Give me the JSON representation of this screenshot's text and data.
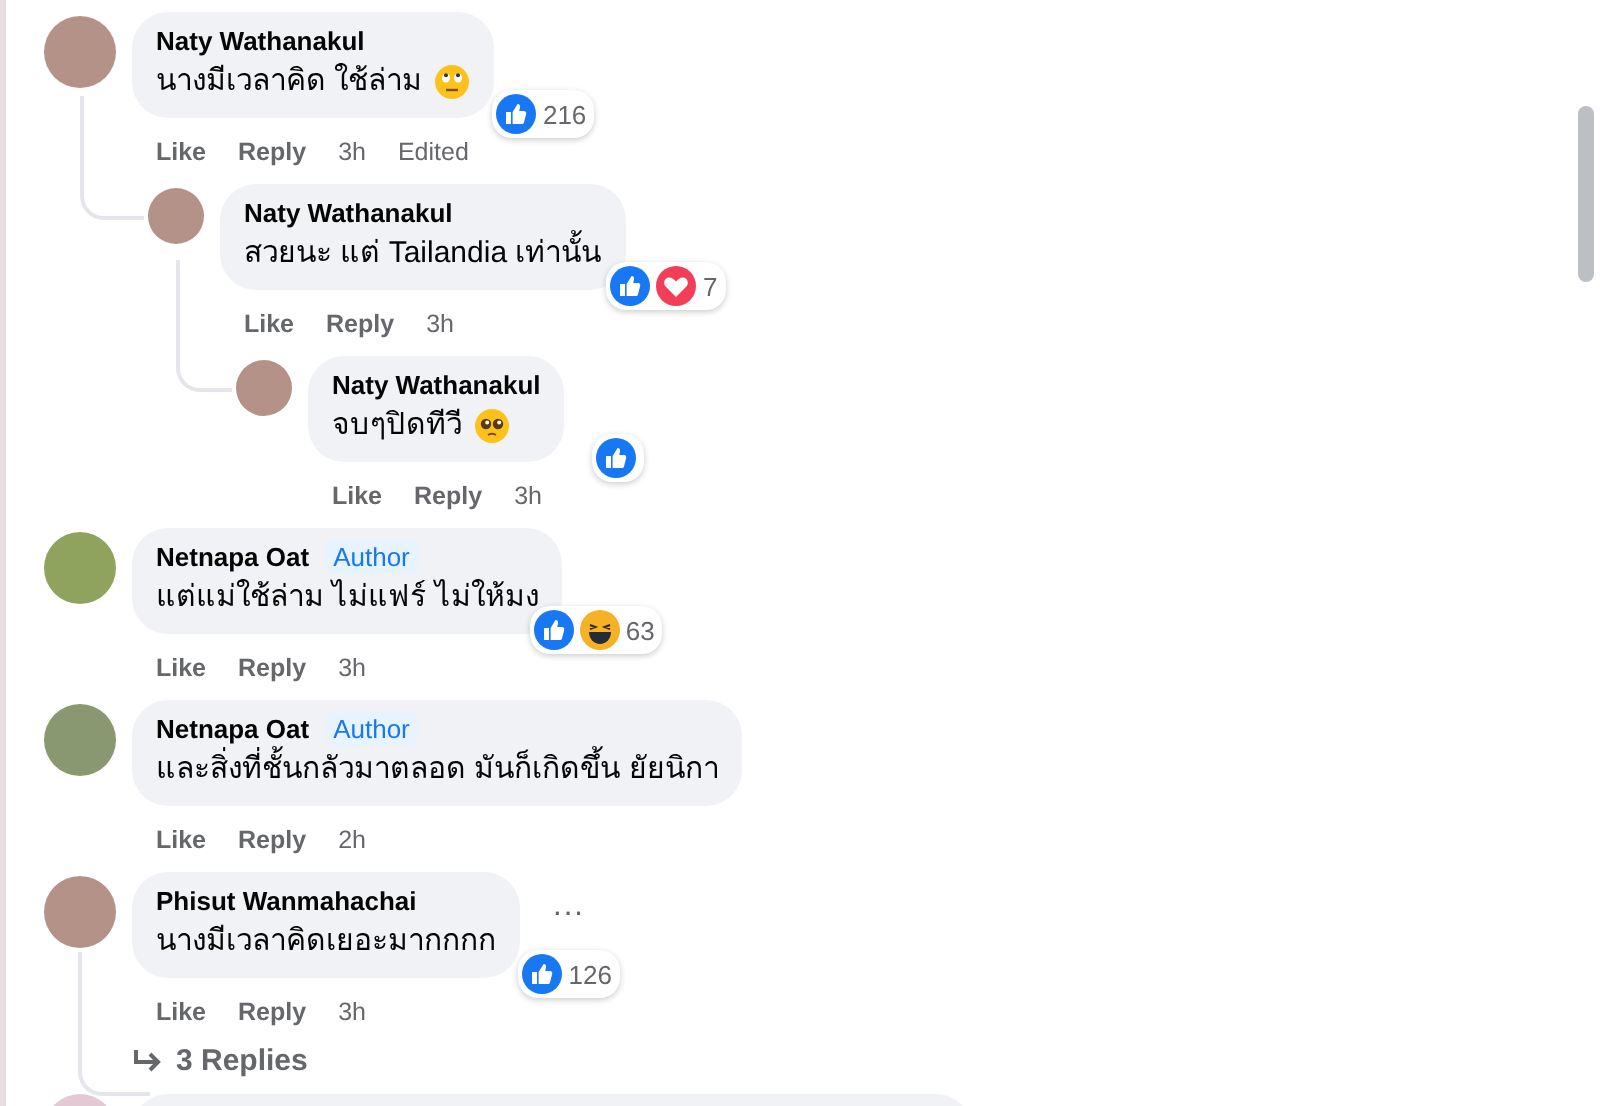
{
  "comments": [
    {
      "author": "Naty Wathanakul",
      "text": "นางมีเวลาคิด ใช้ล่าม",
      "emoji": {
        "kind": "eye-roll"
      },
      "reactions": {
        "items": [
          {
            "kind": "like"
          }
        ],
        "count": "216"
      },
      "actions": [
        "Like",
        "Reply",
        "3h",
        "Edited"
      ],
      "children": [
        {
          "author": "Naty Wathanakul",
          "text": "สวยนะ แต่ Tailandia เท่านั้น",
          "reactions": {
            "items": [
              {
                "kind": "like"
              },
              {
                "kind": "love"
              }
            ],
            "count": "7"
          },
          "actions": [
            "Like",
            "Reply",
            "3h"
          ],
          "children": [
            {
              "author": "Naty Wathanakul",
              "text": "จบๆปิดทีวี",
              "emoji": {
                "kind": "pleading"
              },
              "reactions": {
                "items": [
                  {
                    "kind": "like"
                  }
                ]
              },
              "actions": [
                "Like",
                "Reply",
                "3h"
              ]
            }
          ]
        }
      ]
    },
    {
      "author": "Netnapa Oat",
      "badge": "Author",
      "text": "แต่แม่ใช้ล่าม ไม่แฟร์ ไม่ให้มง",
      "reactions": {
        "items": [
          {
            "kind": "like"
          },
          {
            "kind": "haha"
          }
        ],
        "count": "63"
      },
      "actions": [
        "Like",
        "Reply",
        "3h"
      ]
    },
    {
      "author": "Netnapa Oat",
      "badge": "Author",
      "text": "และสิ่งที่ชั้นกลัวมาตลอด มันก็เกิดขึ้น ยัยนิกา",
      "actions": [
        "Like",
        "Reply",
        "2h"
      ]
    },
    {
      "author": "Phisut Wanmahachai",
      "text": "นางมีเวลาคิดเยอะมากกกก",
      "more": "···",
      "reactions": {
        "items": [
          {
            "kind": "like"
          }
        ],
        "count": "126"
      },
      "actions": [
        "Like",
        "Reply",
        "3h"
      ],
      "replies_link": "3 Replies"
    }
  ]
}
